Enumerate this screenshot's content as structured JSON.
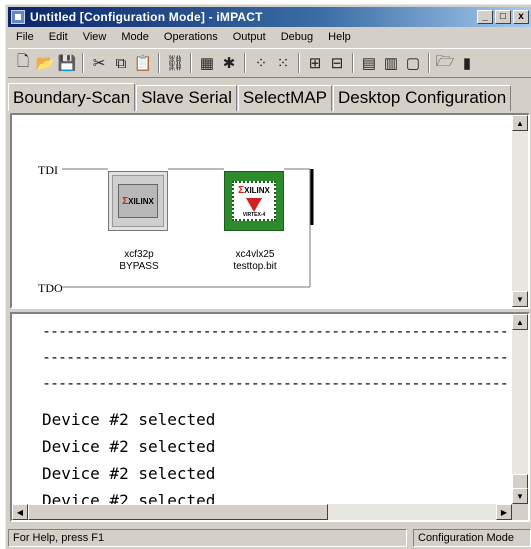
{
  "window": {
    "title": "Untitled [Configuration Mode] - iMPACT",
    "minimize": "_",
    "maximize": "□",
    "close": "x"
  },
  "menu": [
    {
      "label": "File"
    },
    {
      "label": "Edit"
    },
    {
      "label": "View"
    },
    {
      "label": "Mode"
    },
    {
      "label": "Operations"
    },
    {
      "label": "Output"
    },
    {
      "label": "Debug"
    },
    {
      "label": "Help"
    }
  ],
  "toolbar": {
    "icons": [
      "new-icon",
      "open-icon",
      "save-icon",
      "cut-icon",
      "copy-icon",
      "paste-icon",
      "chain-icon",
      "program-icon",
      "identify-icon",
      "grid-icon",
      "grid2-icon",
      "chip-icon",
      "window-icon",
      "assign-icon",
      "erase-icon",
      "blank-icon",
      "file-icon",
      "more-icon"
    ]
  },
  "tabs": [
    {
      "label": "Boundary-Scan",
      "active": true
    },
    {
      "label": "Slave Serial",
      "active": false
    },
    {
      "label": "SelectMAP",
      "active": false
    },
    {
      "label": "Desktop Configuration",
      "active": false
    }
  ],
  "diagram": {
    "tdi_label": "TDI",
    "tdo_label": "TDO",
    "devices": [
      {
        "logo": "XILINX",
        "name": "xcf32p",
        "file": "BYPASS"
      },
      {
        "logo": "XILINX",
        "chip_text": "VIRTEX-4",
        "name": "xc4vlx25",
        "file": "testtop.bit"
      }
    ]
  },
  "log": {
    "dash_line": "----------------------------------------------------------",
    "messages": [
      "Device #2 selected",
      "Device #2 selected",
      "Device #2 selected",
      "Device #2 selected"
    ]
  },
  "status": {
    "help": "For Help, press F1",
    "mode": "Configuration Mode"
  },
  "colors": {
    "titlebar_start": "#0a246a",
    "chip2_green": "#2d8b2d",
    "xilinx_red": "#d21f1f",
    "chrome": "#d4d0c8"
  }
}
